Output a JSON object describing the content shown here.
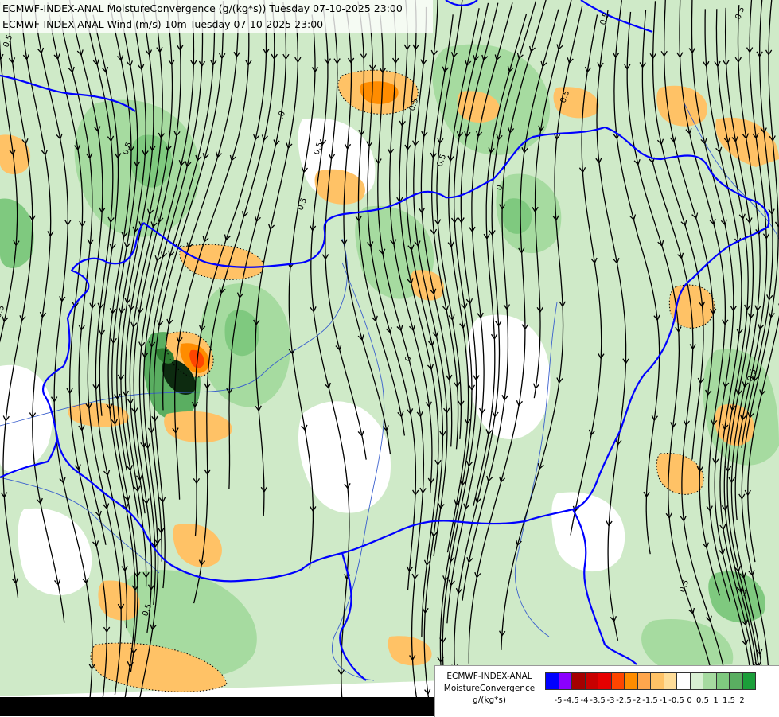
{
  "map": {
    "title_line1": "ECMWF-INDEX-ANAL MoistureConvergence (g/(kg*s)) Tuesday 07-10-2025 23:00",
    "title_line2": "ECMWF-INDEX-ANAL Wind (m/s) 10m Tuesday 07-10-2025 23:00",
    "contour_labels": [
      "0.5",
      "0.5",
      "0.5",
      "0.5",
      "0.5",
      "0",
      "0.5",
      "0",
      "0.5",
      ".0",
      "0.5",
      "0.5",
      "0.5",
      ".5",
      "0.5",
      "0.5",
      "0.5"
    ]
  },
  "legend": {
    "model": "ECMWF-INDEX-ANAL",
    "variable": "MoistureConvergence",
    "unit": "g/(kg*s)",
    "colors": [
      "#0000ff",
      "#8b00ff",
      "#a50000",
      "#c80000",
      "#e60000",
      "#ff4500",
      "#ff8c00",
      "#ffa64d",
      "#ffc266",
      "#ffdd99",
      "#ffffff",
      "#d9f0d3",
      "#a6dba0",
      "#7fc97f",
      "#5aae61",
      "#1b9e3a"
    ],
    "ticks": [
      "-5",
      "-4.5",
      "-4",
      "-3.5",
      "-3",
      "-2.5",
      "-2",
      "-1.5",
      "-1",
      "-0.5",
      "0",
      "0.5",
      "1",
      "1.5",
      "2"
    ]
  },
  "colors": {
    "border": "#0000ff",
    "river": "#3a5fcd",
    "streamline": "#000000",
    "bottom_strip": "#000000"
  }
}
